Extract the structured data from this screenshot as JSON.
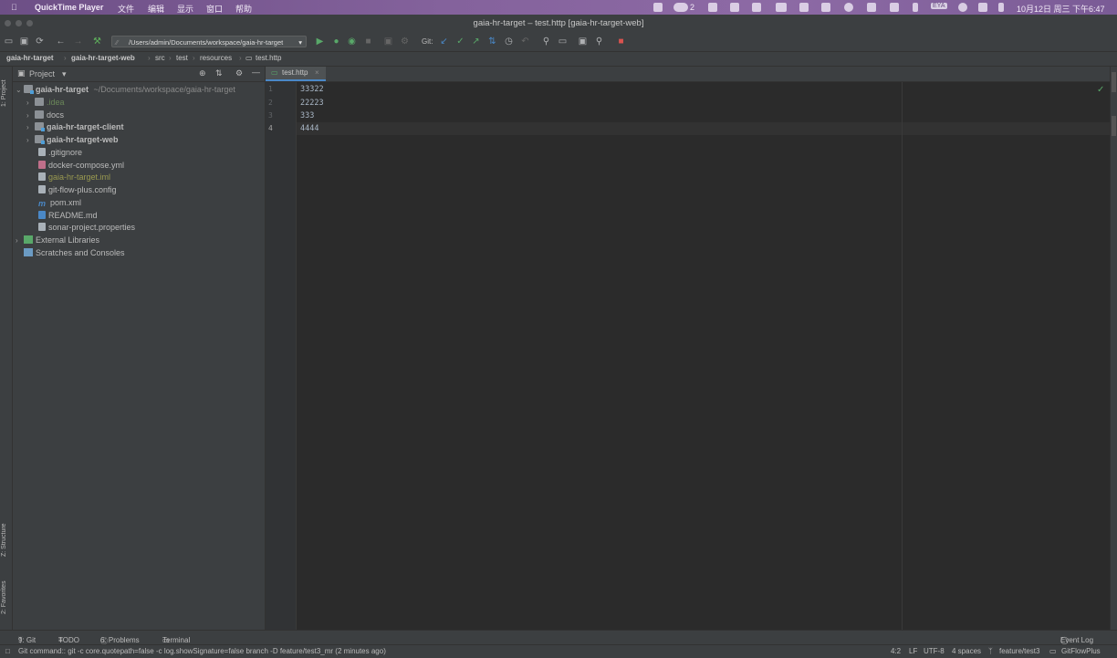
{
  "menubar": {
    "apple_icon": "apple-icon",
    "app_name": "QuickTime Player",
    "menus": [
      "文件",
      "编辑",
      "显示",
      "窗口",
      "帮助"
    ],
    "badge_count": "2",
    "ime": "EYA",
    "clock": "10月12日 周三 下午6:47"
  },
  "window": {
    "title": "gaia-hr-target – test.http [gaia-hr-target-web]"
  },
  "toolbar": {
    "path": "/Users/admin/Documents/workspace/gaia-hr-target",
    "git_label": "Git:"
  },
  "breadcrumb": {
    "items": [
      "gaia-hr-target",
      "gaia-hr-target-web",
      "src",
      "test",
      "resources",
      "test.http"
    ]
  },
  "left_stripe": {
    "project": "1: Project",
    "structure": "Z: Structure",
    "favorites": "2: Favorites"
  },
  "project_panel": {
    "title": "Project",
    "root_name": "gaia-hr-target",
    "root_path": "~/Documents/workspace/gaia-hr-target",
    "items": [
      {
        "label": ".idea",
        "kind": "folder"
      },
      {
        "label": "docs",
        "kind": "folder"
      },
      {
        "label": "gaia-hr-target-client",
        "kind": "module"
      },
      {
        "label": "gaia-hr-target-web",
        "kind": "module"
      },
      {
        "label": ".gitignore",
        "kind": "file"
      },
      {
        "label": "docker-compose.yml",
        "kind": "file"
      },
      {
        "label": "gaia-hr-target.iml",
        "kind": "file"
      },
      {
        "label": "git-flow-plus.config",
        "kind": "file"
      },
      {
        "label": "pom.xml",
        "kind": "file"
      },
      {
        "label": "README.md",
        "kind": "file"
      },
      {
        "label": "sonar-project.properties",
        "kind": "file"
      }
    ],
    "external_libraries": "External Libraries",
    "scratches": "Scratches and Consoles"
  },
  "editor": {
    "tab_label": "test.http",
    "line_numbers": [
      "1",
      "2",
      "3",
      "4"
    ],
    "lines": [
      "33322",
      "22223",
      "333",
      "4444"
    ]
  },
  "tool_windows": {
    "git": "9: Git",
    "todo": "TODO",
    "problems": "6: Problems",
    "terminal": "Terminal",
    "event_log": "Event Log"
  },
  "status": {
    "message": "Git command:: git -c core.quotepath=false -c log.showSignature=false branch -D feature/test3_mr (2 minutes ago)",
    "position": "4:2",
    "line_sep": "LF",
    "encoding": "UTF-8",
    "indent": "4 spaces",
    "branch": "feature/test3",
    "plugin": "GitFlowPlus"
  },
  "colors": {
    "accent": "#4a88c7",
    "idea_green": "#6a8759",
    "iml_olive": "#9a9a50",
    "check_green": "#59a869"
  }
}
